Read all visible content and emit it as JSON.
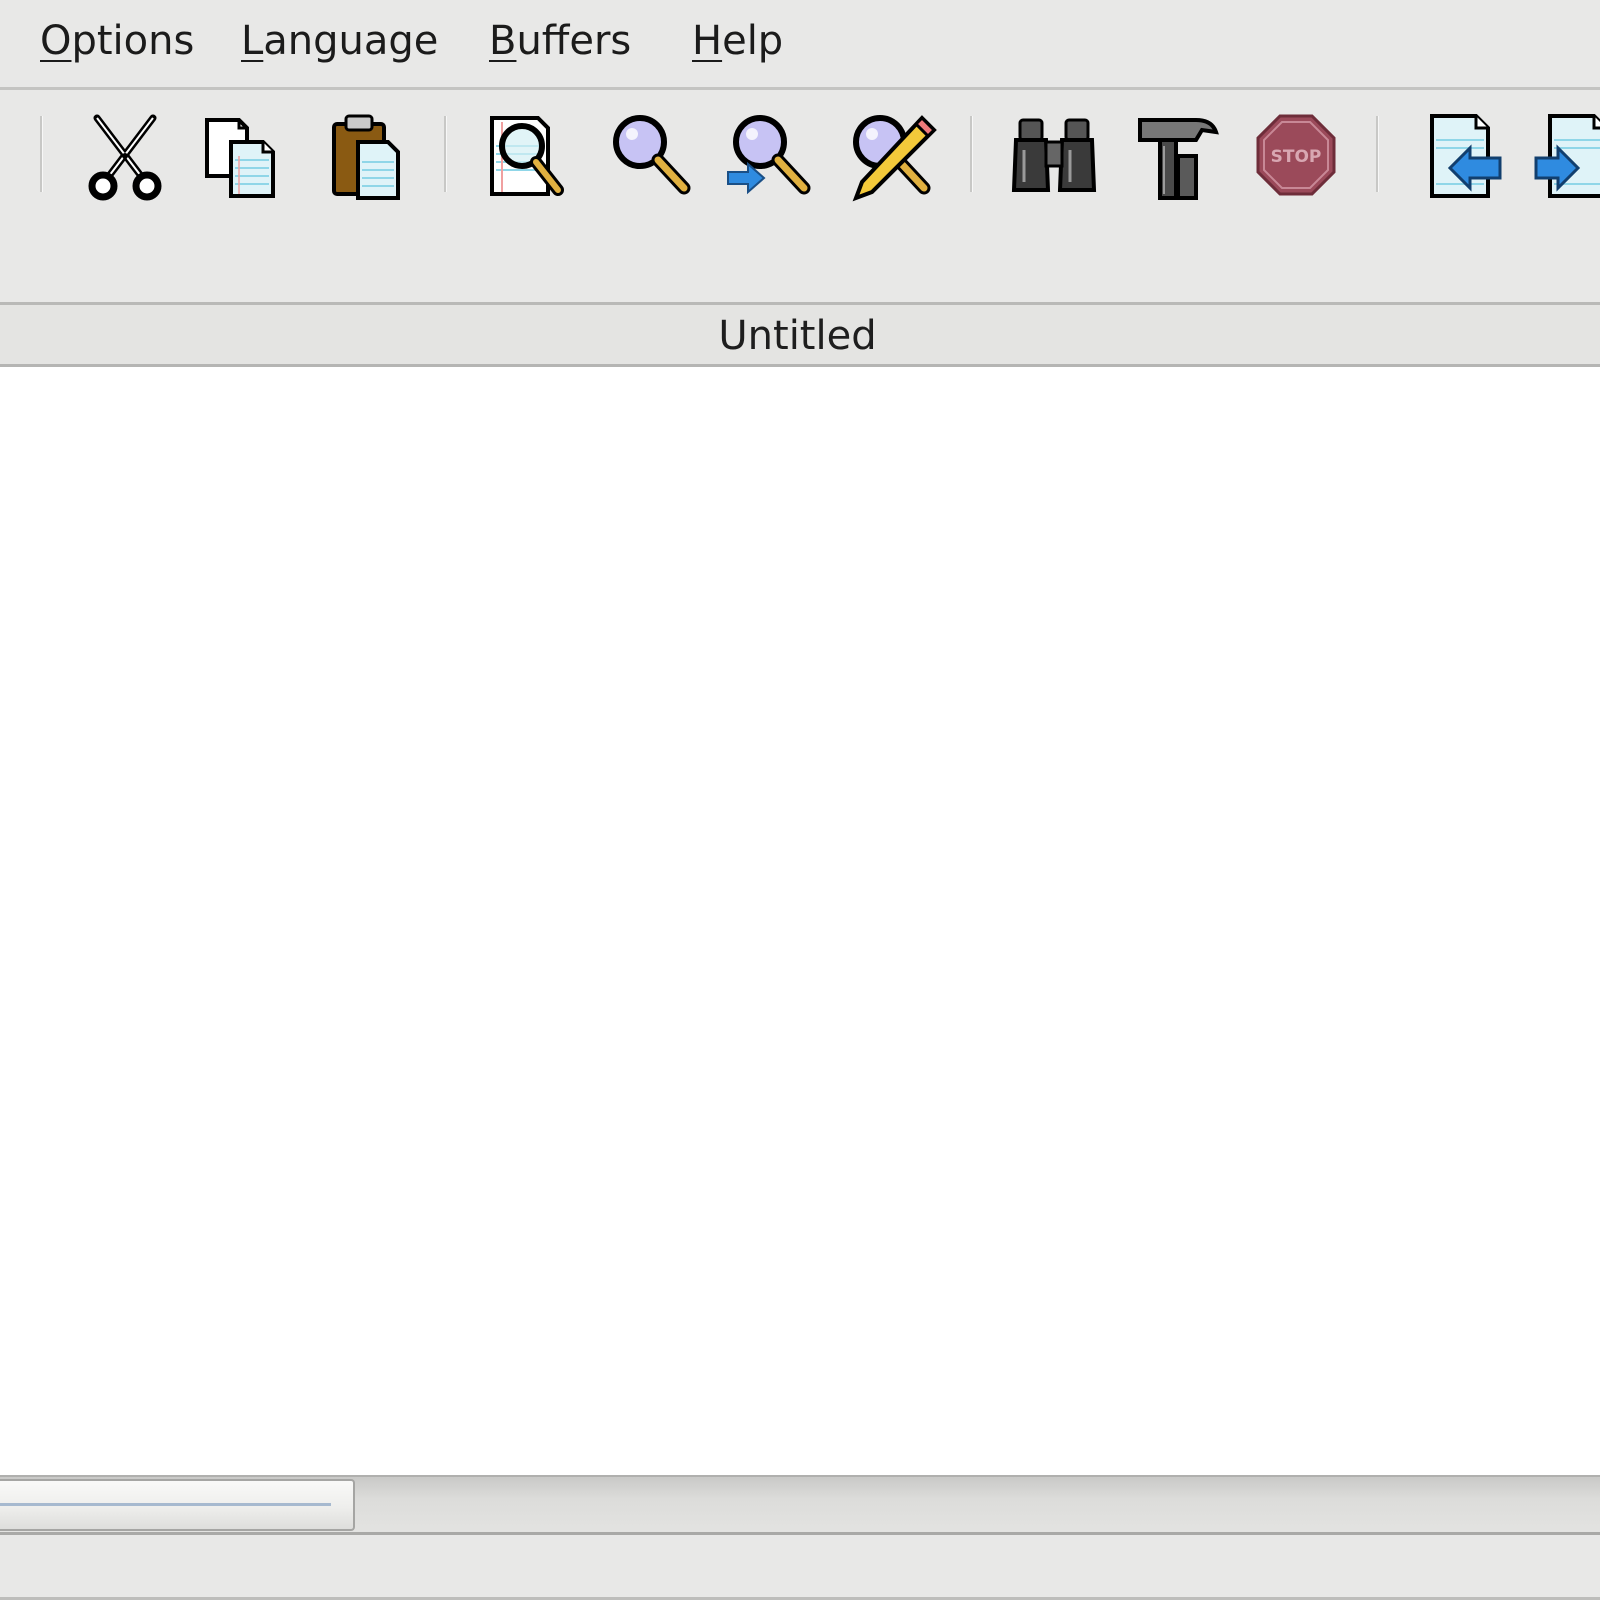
{
  "menubar": {
    "items": [
      {
        "label_mnemonic": "O",
        "label_rest": "ptions"
      },
      {
        "label_mnemonic": "L",
        "label_rest": "anguage"
      },
      {
        "label_mnemonic": "B",
        "label_rest": "uffers"
      },
      {
        "label_mnemonic": "H",
        "label_rest": "elp"
      }
    ]
  },
  "toolbar": {
    "buttons": [
      {
        "icon": "scissors-icon"
      },
      {
        "icon": "copy-icon"
      },
      {
        "icon": "paste-icon"
      },
      {
        "icon": "find-in-document-icon"
      },
      {
        "icon": "find-icon"
      },
      {
        "icon": "find-next-icon"
      },
      {
        "icon": "find-replace-icon"
      },
      {
        "icon": "binoculars-icon"
      },
      {
        "icon": "hammer-icon"
      },
      {
        "icon": "stop-icon",
        "text": "STOP"
      },
      {
        "icon": "previous-buffer-icon"
      },
      {
        "icon": "next-buffer-icon"
      }
    ]
  },
  "buffer": {
    "title": "Untitled"
  },
  "colors": {
    "chrome": "#e8e8e7",
    "editor_bg": "#ffffff",
    "stop_red": "#9b4a5a",
    "arrow_blue": "#2f8be0"
  }
}
